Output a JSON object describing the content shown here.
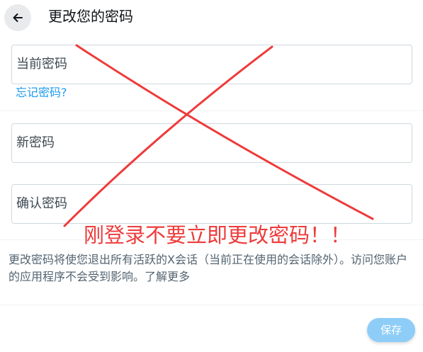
{
  "header": {
    "title": "更改您的密码",
    "back_icon": "arrow-left-icon"
  },
  "form": {
    "current_password_label": "当前密码",
    "forgot_password_link": "忘记密码?",
    "new_password_label": "新密码",
    "confirm_password_label": "确认密码"
  },
  "description": "更改密码将使您退出所有活跃的X会话（当前正在使用的会话除外）。访问您账户的应用程序不会受到影响。了解更多",
  "actions": {
    "save_label": "保存"
  },
  "overlay": {
    "annotation": "刚登录不要立即更改密码！！",
    "color": "#ee3b3b"
  },
  "colors": {
    "link": "#1d9bf0",
    "save_button_bg": "#8ecdf8",
    "field_border": "#cfd9de"
  }
}
